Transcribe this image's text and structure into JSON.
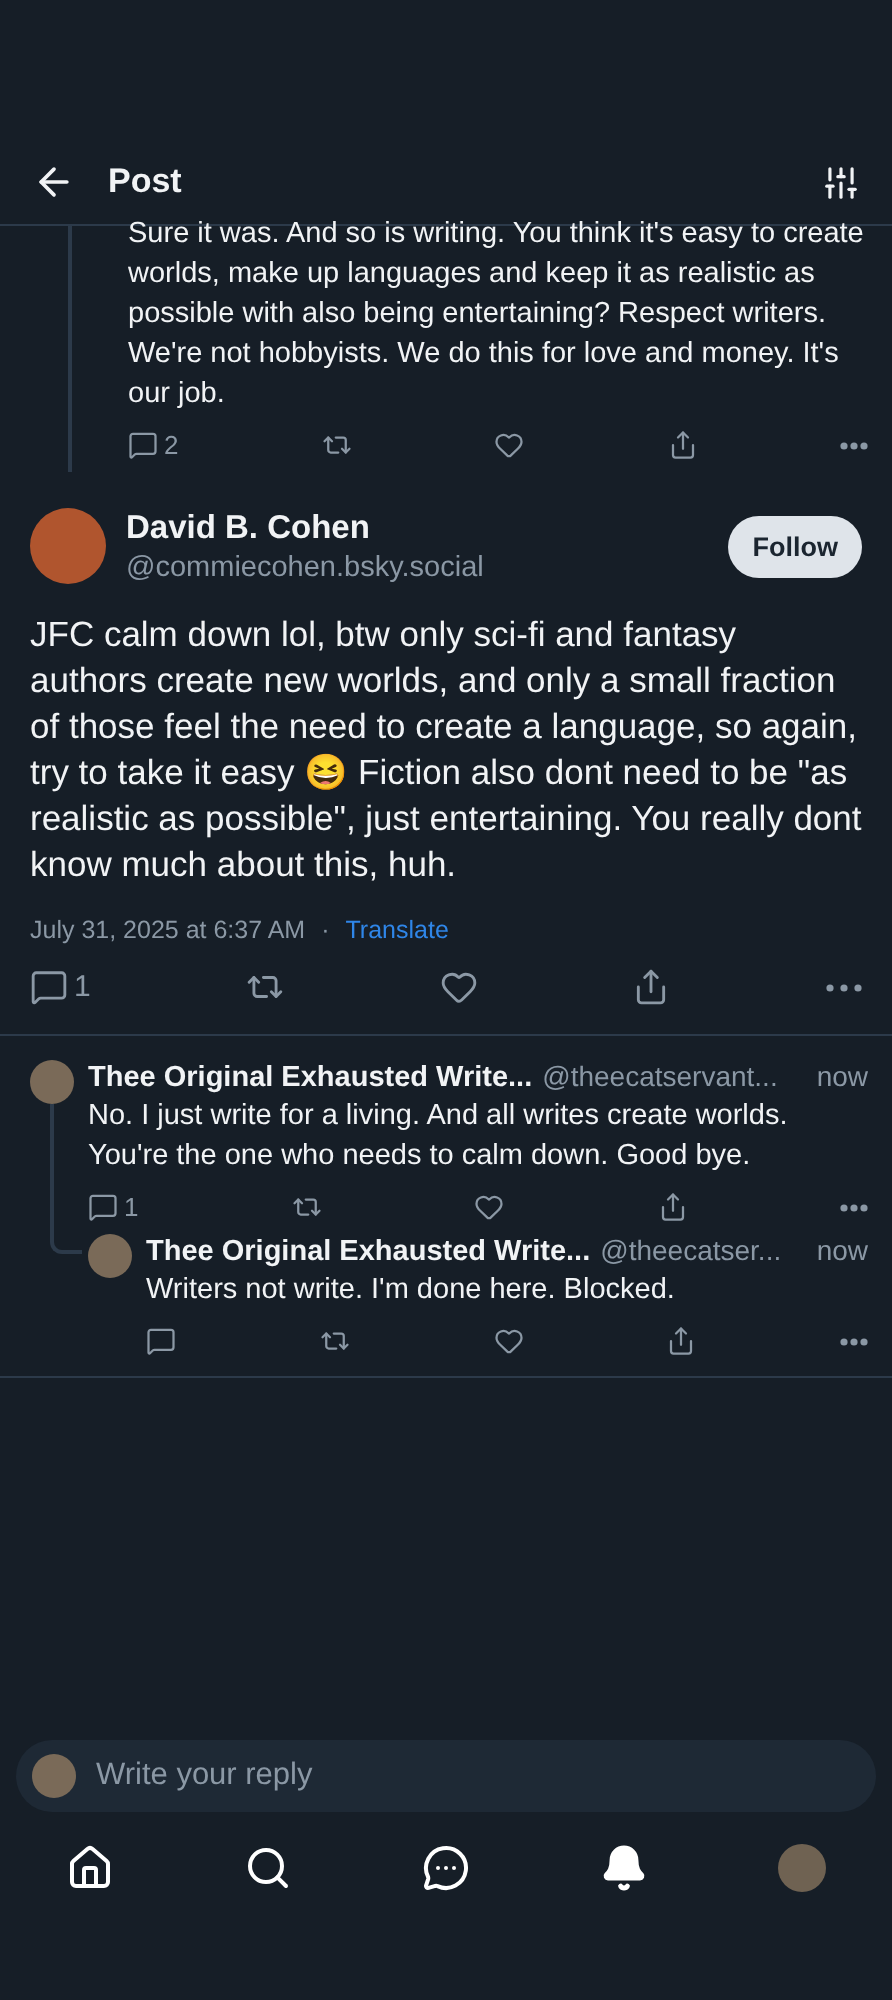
{
  "header": {
    "title": "Post"
  },
  "parent_post": {
    "text": "Sure it was. And so is writing. You think it's easy to create worlds, make up languages and keep it as realistic as possible with also being entertaining? Respect writers. We're not hobbyists. We do this for love and money. It's our job.",
    "actions": [
      {
        "kind": "reply",
        "count": "2"
      },
      {
        "kind": "repost"
      },
      {
        "kind": "like"
      },
      {
        "kind": "share"
      },
      {
        "kind": "more"
      }
    ]
  },
  "main_post": {
    "author": "David B. Cohen",
    "handle": "@commiecohen.bsky.social",
    "follow_label": "Follow",
    "text": "JFC calm down lol, btw only sci-fi and fantasy authors create new worlds, and only a small fraction of those feel the need to create a language, so again, try to take it easy 😆 Fiction also dont need to be \"as realistic as possible\", just entertaining. You really dont know much about this, huh.",
    "timestamp": "July 31, 2025 at 6:37 AM",
    "separator": "·",
    "translate": "Translate",
    "actions": [
      {
        "kind": "reply",
        "count": "1"
      },
      {
        "kind": "repost"
      },
      {
        "kind": "like"
      },
      {
        "kind": "share"
      },
      {
        "kind": "more"
      }
    ]
  },
  "replies": [
    {
      "author": "Thee Original Exhausted Write...",
      "handle": "@theecatservant...",
      "time": "now",
      "text": "No. I just write for a living. And all writes create worlds. You're the one who needs to calm down. Good bye.",
      "actions": [
        {
          "kind": "reply",
          "count": "1"
        },
        {
          "kind": "repost"
        },
        {
          "kind": "like"
        },
        {
          "kind": "share"
        },
        {
          "kind": "more"
        }
      ],
      "children": [
        {
          "author": "Thee Original Exhausted Write...",
          "handle": "@theecatser...",
          "time": "now",
          "text": "Writers not write. I'm done here. Blocked.",
          "actions": [
            {
              "kind": "reply"
            },
            {
              "kind": "repost"
            },
            {
              "kind": "like"
            },
            {
              "kind": "share"
            },
            {
              "kind": "more"
            }
          ]
        }
      ]
    }
  ],
  "composer": {
    "placeholder": "Write your reply"
  },
  "nav": [
    {
      "kind": "home",
      "selected": false
    },
    {
      "kind": "search",
      "selected": false
    },
    {
      "kind": "chat",
      "selected": false
    },
    {
      "kind": "notifications",
      "selected": true
    },
    {
      "kind": "profile",
      "selected": false
    }
  ]
}
